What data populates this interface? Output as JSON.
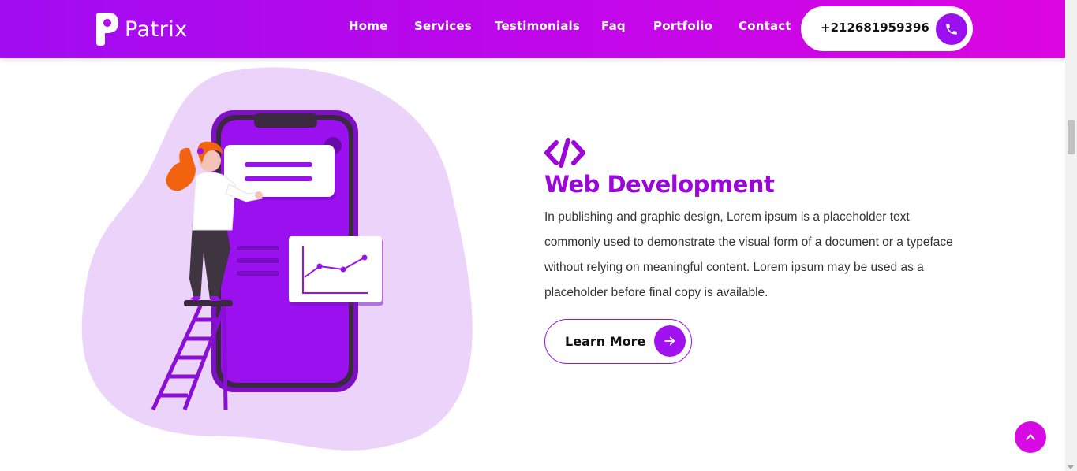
{
  "header": {
    "brand": "Patrix",
    "nav": [
      {
        "label": "Home"
      },
      {
        "label": "Services"
      },
      {
        "label": "Testimonials"
      },
      {
        "label": "Faq"
      },
      {
        "label": "Portfolio"
      },
      {
        "label": "Contact"
      }
    ],
    "phone": "+212681959396"
  },
  "service": {
    "icon": "code-icon",
    "title": "Web Development",
    "description": "In publishing and graphic design, Lorem ipsum is a placeholder text commonly used to demonstrate the visual form of a document or a typeface without relying on meaningful content. Lorem ipsum may be used as a placeholder before final copy is available.",
    "button_label": "Learn More"
  },
  "colors": {
    "accent": "#9b10ee",
    "title": "#9b07d8",
    "header_start": "#a10cf0",
    "header_end": "#dc06e0",
    "blob": "#ecd3fa",
    "scroll_top": "#d90be4"
  }
}
